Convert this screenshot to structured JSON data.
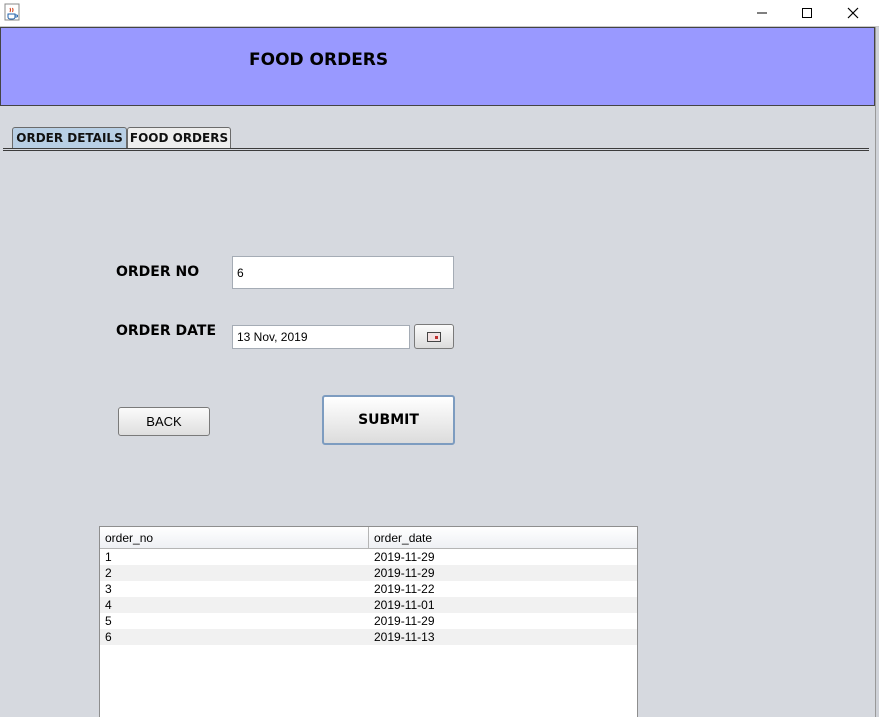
{
  "window": {
    "icon": "java-coffee-icon",
    "controls": [
      "minimize-icon",
      "maximize-icon",
      "close-icon"
    ]
  },
  "header": {
    "title": "FOOD ORDERS",
    "background": "#9999ff"
  },
  "tabs": [
    {
      "label": "ORDER DETAILS",
      "active": true
    },
    {
      "label": "FOOD ORDERS",
      "active": false
    }
  ],
  "form": {
    "order_no_label": "ORDER NO",
    "order_no_value": "6",
    "order_date_label": "ORDER DATE",
    "order_date_value": "13 Nov, 2019",
    "calendar_icon": "calendar-icon",
    "back_label": "BACK",
    "submit_label": "SUBMIT"
  },
  "table": {
    "columns": [
      "order_no",
      "order_date"
    ],
    "rows": [
      [
        "1",
        "2019-11-29"
      ],
      [
        "2",
        "2019-11-29"
      ],
      [
        "3",
        "2019-11-22"
      ],
      [
        "4",
        "2019-11-01"
      ],
      [
        "5",
        "2019-11-29"
      ],
      [
        "6",
        "2019-11-13"
      ]
    ]
  }
}
